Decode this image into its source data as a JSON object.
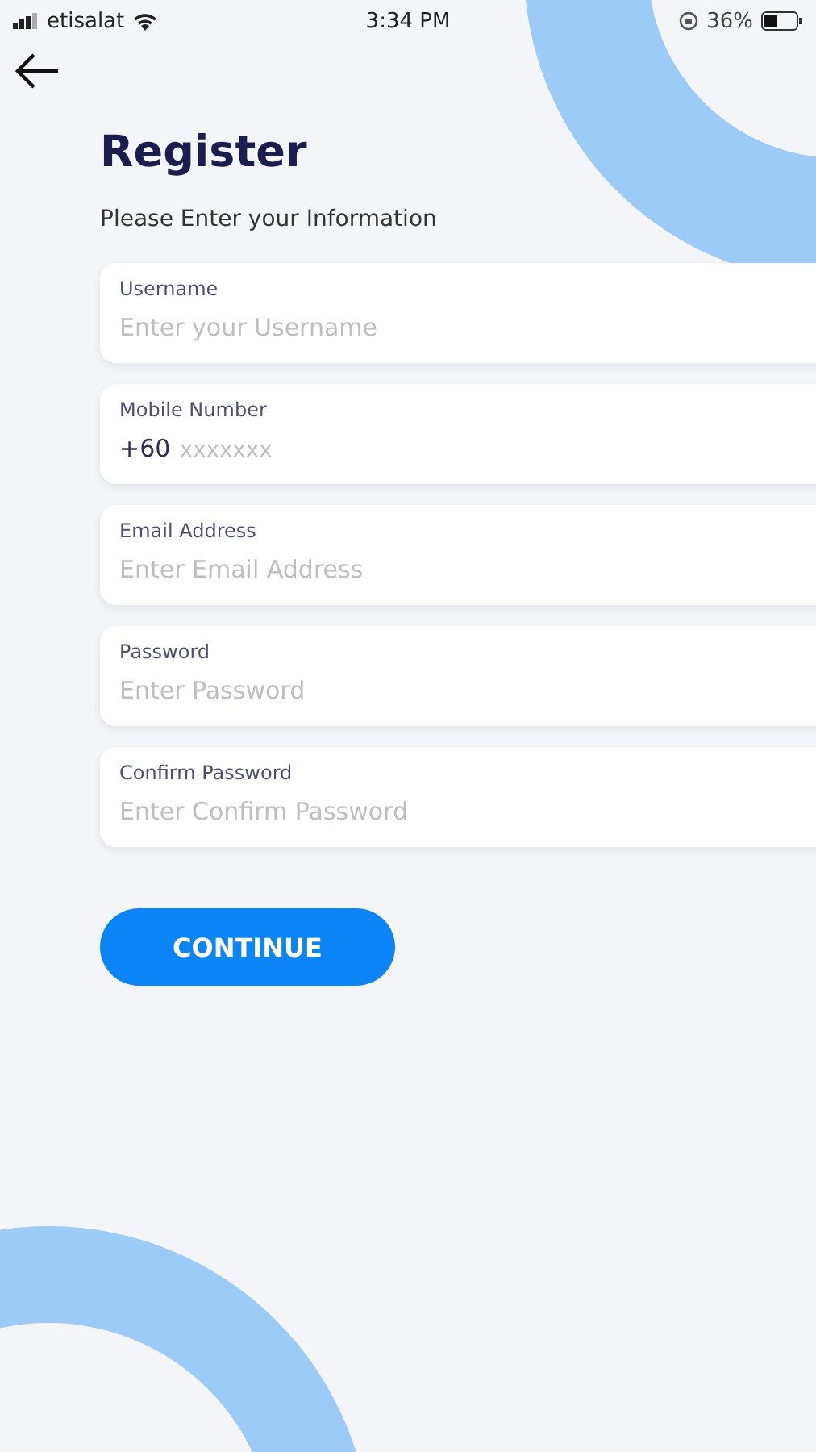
{
  "status_bar": {
    "carrier": "etisalat",
    "time": "3:34 PM",
    "battery": "36%"
  },
  "title": "Register",
  "subtitle": "Please Enter your Information",
  "fields": [
    {
      "label": "Username",
      "placeholder": "Enter your Username"
    },
    {
      "label": "Mobile Number",
      "prefix": "+60",
      "placeholder": "xxxxxxx"
    },
    {
      "label": "Email Address",
      "placeholder": "Enter Email Address"
    },
    {
      "label": "Password",
      "placeholder": "Enter Password"
    },
    {
      "label": "Confirm Password",
      "placeholder": "Enter Confirm Password"
    }
  ],
  "button": "CONTINUE"
}
